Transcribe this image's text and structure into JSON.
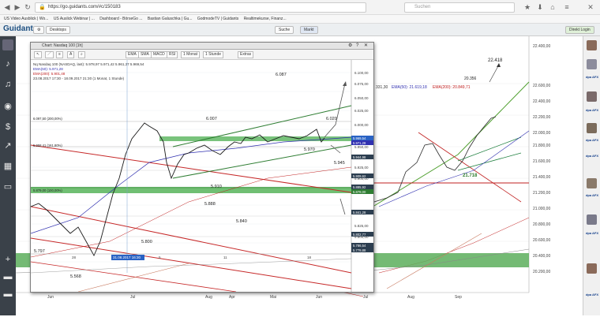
{
  "browser": {
    "url": "https://go.guidants.com/#c/150183",
    "search_placeholder": "Suchen",
    "bookmarks": [
      "US Video Ausblick | Wo...",
      "US Auslick Webinar | ...",
      "Dashboard - BörseGo ...",
      "Bastian Galuschka | Gu...",
      "GodmodeTV | Guidants",
      "Realtimekurse, Finanz..."
    ]
  },
  "app": {
    "brand": "Guidants",
    "desktop_label": "Desktops",
    "suche_label": "Suche",
    "markt_label": "Markt",
    "login_label": "Direkt Login"
  },
  "chart_window": {
    "title": "Chart: Nasdaq 100 [1h]",
    "toolbar": [
      "EMA",
      "SMA",
      "MACD",
      "RSI",
      "1 Monat",
      "1 Stunde",
      "Extras"
    ],
    "info": [
      "Nq  Nasdaq 100 (NASDAQ, last): 5.978,97  5.971,42  5.961,37  5.969,54",
      "EMA(50): 5.971,28",
      "EMA(200): 5.901,48",
      "23.08.2017 17:30 - 18.09.2017 21:30 (1 Monat, 1 Stunde)"
    ],
    "levels": [
      "6.087",
      "6.007",
      "6.020",
      "5.970",
      "5.945",
      "5.910",
      "5.888",
      "5.840",
      "5.800",
      "5.797",
      "5.568"
    ],
    "level_labels": [
      "6.097,50 (200,00%)",
      "5.958,41 (161,80%)",
      "5.879,00 (100,00%)"
    ],
    "yticks": [
      "6.100,00",
      "6.075,00",
      "6.050,00",
      "6.025,00",
      "6.000,00",
      "5.975,00",
      "5.950,00",
      "5.925,00",
      "5.900,00",
      "5.875,00",
      "5.850,00",
      "5.825,00",
      "5.800,00",
      "5.775,00"
    ],
    "price_tags": [
      "5.969,54",
      "5.971,28",
      "5.944,98",
      "5.909,62",
      "5.885,92",
      "5.879,00",
      "5.841,28",
      "5.802,77",
      "5.786,54",
      "5.779,88"
    ],
    "xticks": [
      "28",
      "31.08.2017 16:30",
      "5",
      "11",
      "18"
    ]
  },
  "main_chart": {
    "info": [
      "331,30",
      "EMA(50): 21.619,18",
      "EMA(200): 20.849,71"
    ],
    "levels": [
      "22.418",
      "21.718"
    ],
    "top_partial": "20.356",
    "yticks": [
      "22.400,00",
      "22.600,00",
      "22.400,00",
      "22.200,00",
      "22.000,00",
      "21.800,00",
      "21.600,00",
      "21.400,00",
      "21.200,00",
      "21.000,00",
      "20.800,00",
      "20.600,00",
      "20.400,00",
      "20.200,00"
    ],
    "xticks": [
      "Jun",
      "Jul",
      "Aug",
      "Apr",
      "Mai",
      "Jun",
      "Jul",
      "Aug",
      "Sep"
    ],
    "sep_badge": "Sep"
  },
  "news_badges": [
    "dpa AFX",
    "dpa AFX",
    "dpa AFX",
    "dpa AFX",
    "dpa AFX",
    "dpa AFX",
    "dpa AFX"
  ]
}
